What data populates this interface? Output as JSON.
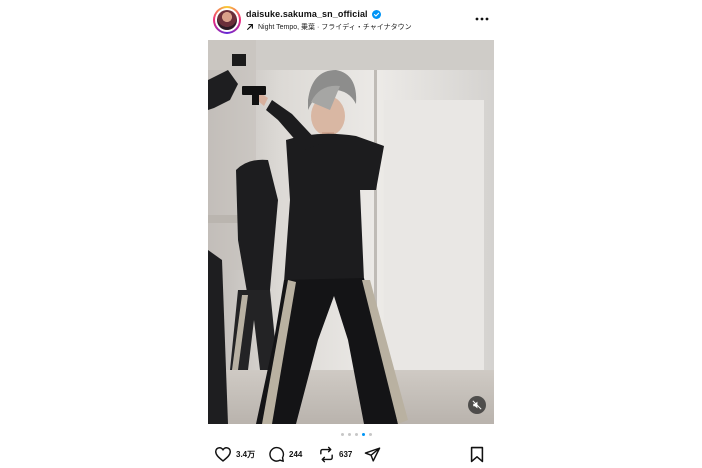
{
  "post": {
    "username": "daisuke.sakuma_sn_official",
    "music_icon": "arrow-up-right-icon",
    "music_text": "Night Tempo, 乗葉 · フライディ・チャイナタウン",
    "more_icon": "more-horizontal-icon",
    "verified_icon": "verified-badge-icon",
    "verified_color": "#0095f6"
  },
  "media": {
    "mute_icon": "speaker-muted-icon",
    "carousel_count": 5,
    "carousel_active_index": 3
  },
  "actions": {
    "like_icon": "heart-icon",
    "like_count": "3.4万",
    "comment_icon": "comment-bubble-icon",
    "comment_count": "244",
    "repost_icon": "repost-icon",
    "repost_count": "637",
    "share_icon": "paper-plane-icon",
    "save_icon": "bookmark-icon"
  },
  "colors": {
    "accent": "#0095f6",
    "text": "#111111",
    "dot_inactive": "#c7c7c7"
  }
}
